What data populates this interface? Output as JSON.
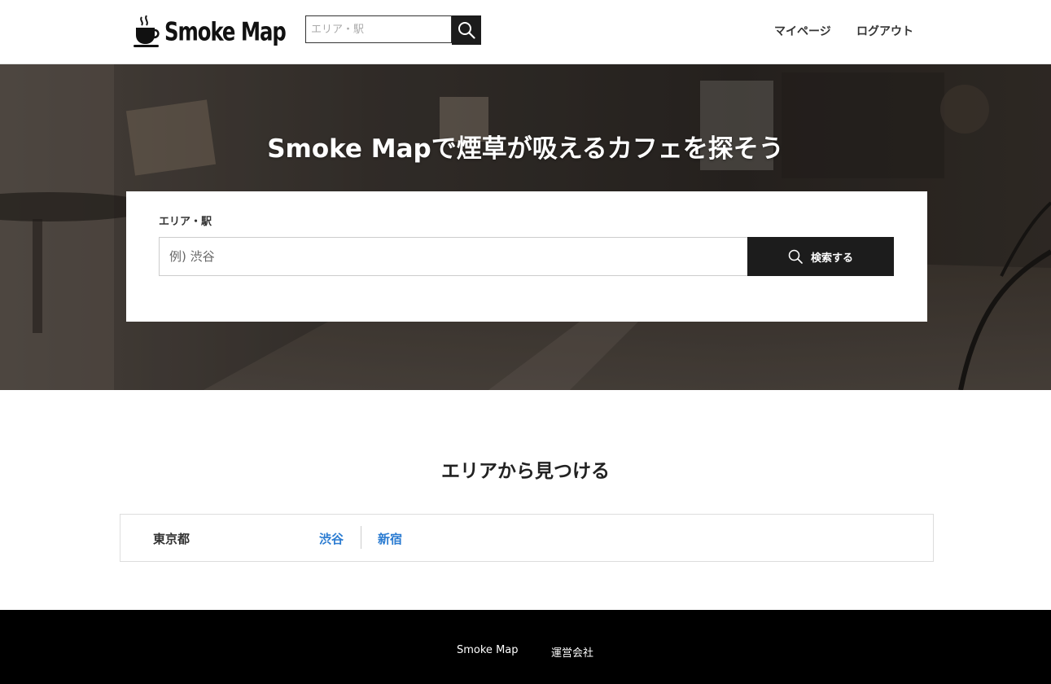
{
  "header": {
    "logo_text": "Smoke Map",
    "search_placeholder": "エリア・駅",
    "nav": {
      "mypage": "マイページ",
      "logout": "ログアウト"
    }
  },
  "hero": {
    "title": "Smoke Mapで煙草が吸えるカフェを探そう",
    "search": {
      "label": "エリア・駅",
      "placeholder": "例) 渋谷",
      "button_label": "検索する"
    }
  },
  "areas": {
    "title": "エリアから見つける",
    "prefecture": "東京都",
    "cities": [
      "渋谷",
      "新宿"
    ]
  },
  "footer": {
    "links": [
      "Smoke Map",
      "運営会社"
    ]
  },
  "colors": {
    "accent_link": "#2a7bd1",
    "button_dark": "#1c1c1c",
    "footer_bg": "#000000"
  }
}
